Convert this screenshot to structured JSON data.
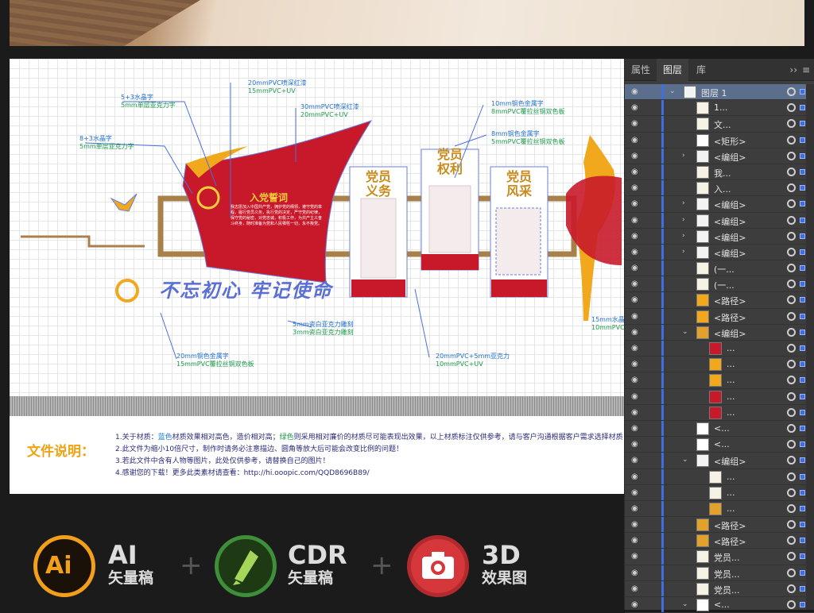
{
  "canvas": {
    "annotations": [
      {
        "a": "20mmPVC喷深红漆",
        "b": "15mmPVC+UV"
      },
      {
        "a": "5+3水晶字",
        "b": "5mm单层亚克力字"
      },
      {
        "a": "30mmPVC喷深红漆",
        "b": "20mmPVC+UV"
      },
      {
        "a": "8+3水晶字",
        "b": "5mm单层亚克力字"
      },
      {
        "a": "10mm铜色金属字",
        "b": "8mmPVC覆拉丝铜双色板"
      },
      {
        "a": "8mm铜色金属字",
        "b": "5mmPVC覆拉丝铜双色板"
      },
      {
        "a": "5mm瓷白亚克力雕刻",
        "b": "3mm瓷白亚克力雕刻"
      },
      {
        "a": "20mm铜色金属字",
        "b": "15mmPVC覆拉丝铜双色板"
      },
      {
        "a": "20mmPVC+5mm亚克力",
        "b": "10mmPVC+UV"
      },
      {
        "a": "15mm水晶",
        "b": "10mmPVC"
      }
    ],
    "slogan": "不忘初心 牢记使命",
    "oath_title": "入党誓词",
    "oath_body": "我志愿加入中国共产党，拥护党的纲领，遵守党的章程，履行党员义务，执行党的决定，严守党的纪律，保守党的秘密，对党忠诚，积极工作，为共产主义奋斗终身，随时准备为党和人民牺牲一切，永不叛党。",
    "panels": [
      {
        "line1": "党员",
        "line2": "义务"
      },
      {
        "line1": "党员",
        "line2": "权利"
      },
      {
        "line1": "党员",
        "line2": "风采"
      }
    ]
  },
  "notes": {
    "label": "文件说明：",
    "lines": [
      {
        "pre": "1.关于材质：",
        "hl1": "蓝色",
        "mid": "材质效果相对高色，造价相对高；",
        "hl2": "绿色",
        "post": "则采用相对廉价的材质尽可能表现出效果，以上材质标注仅供参考，请与客户沟通根据客户需求选择材质，或咨询"
      },
      {
        "pre": "2.此文件为缩小10倍尺寸，制作时请务必注意描边、圆角等放大后可能会改变比例的问题！"
      },
      {
        "pre": "3.若此文件中含有人物等图片，此处仅供参考，请替换自己的图片！"
      },
      {
        "pre": "4.感谢您的下载！更多此类素材请查看：http://hi.ooopic.com/QQD8696B89/"
      }
    ]
  },
  "footer": {
    "badges": [
      {
        "icon": "ai-icon",
        "glyph": "Ai",
        "big": "AI",
        "small": "矢量稿",
        "color": "#f29f1b"
      },
      {
        "icon": "coreldraw-icon",
        "glyph": "",
        "big": "CDR",
        "small": "矢量稿",
        "color": "#3e8e3a"
      },
      {
        "icon": "camera-icon",
        "glyph": "",
        "big": "3D",
        "small": "效果图",
        "color": "#d5373b"
      }
    ]
  },
  "layers_panel": {
    "tabs": [
      "属性",
      "图层",
      "库"
    ],
    "active_tab": "图层",
    "more_label": "››",
    "menu_label": "≡",
    "rows": [
      {
        "indent": 0,
        "twisty": "⌄",
        "name": "图层 1",
        "selected": true,
        "thumb": "layer"
      },
      {
        "indent": 1,
        "twisty": "",
        "name": "1...",
        "thumb": "text"
      },
      {
        "indent": 1,
        "twisty": "",
        "name": "文...",
        "thumb": "text"
      },
      {
        "indent": 1,
        "twisty": "",
        "name": "<矩形>",
        "thumb": "blank"
      },
      {
        "indent": 1,
        "twisty": "›",
        "name": "<编组>",
        "thumb": "group"
      },
      {
        "indent": 1,
        "twisty": "",
        "name": "我...",
        "thumb": "text"
      },
      {
        "indent": 1,
        "twisty": "",
        "name": "入...",
        "thumb": "text"
      },
      {
        "indent": 1,
        "twisty": "›",
        "name": "<编组>",
        "thumb": "group"
      },
      {
        "indent": 1,
        "twisty": "›",
        "name": "<编组>",
        "thumb": "group"
      },
      {
        "indent": 1,
        "twisty": "›",
        "name": "<编组>",
        "thumb": "group"
      },
      {
        "indent": 1,
        "twisty": "›",
        "name": "<编组>",
        "thumb": "group"
      },
      {
        "indent": 1,
        "twisty": "",
        "name": "(一...",
        "thumb": "text"
      },
      {
        "indent": 1,
        "twisty": "",
        "name": "(一...",
        "thumb": "text"
      },
      {
        "indent": 1,
        "twisty": "",
        "name": "<路径>",
        "thumb": "bird"
      },
      {
        "indent": 1,
        "twisty": "",
        "name": "<路径>",
        "thumb": "bird"
      },
      {
        "indent": 1,
        "twisty": "⌄",
        "name": "<编组>",
        "thumb": "emblem"
      },
      {
        "indent": 2,
        "twisty": "",
        "name": "...",
        "thumb": "red"
      },
      {
        "indent": 2,
        "twisty": "",
        "name": "...",
        "thumb": "orange"
      },
      {
        "indent": 2,
        "twisty": "",
        "name": "...",
        "thumb": "orange"
      },
      {
        "indent": 2,
        "twisty": "",
        "name": "...",
        "thumb": "red"
      },
      {
        "indent": 2,
        "twisty": "",
        "name": "...",
        "thumb": "red"
      },
      {
        "indent": 1,
        "twisty": "",
        "name": "<...",
        "thumb": "blank"
      },
      {
        "indent": 1,
        "twisty": "",
        "name": "<...",
        "thumb": "blank"
      },
      {
        "indent": 1,
        "twisty": "⌄",
        "name": "<编组>",
        "thumb": "group"
      },
      {
        "indent": 2,
        "twisty": "",
        "name": "...",
        "thumb": "text"
      },
      {
        "indent": 2,
        "twisty": "",
        "name": "...",
        "thumb": "text"
      },
      {
        "indent": 2,
        "twisty": "",
        "name": "...",
        "thumb": "emblem"
      },
      {
        "indent": 1,
        "twisty": "",
        "name": "<路径>",
        "thumb": "emblem"
      },
      {
        "indent": 1,
        "twisty": "",
        "name": "<路径>",
        "thumb": "emblem"
      },
      {
        "indent": 1,
        "twisty": "",
        "name": "党员...",
        "thumb": "text"
      },
      {
        "indent": 1,
        "twisty": "",
        "name": "党员...",
        "thumb": "text"
      },
      {
        "indent": 1,
        "twisty": "",
        "name": "党员...",
        "thumb": "text"
      },
      {
        "indent": 1,
        "twisty": "⌄",
        "name": "<...",
        "thumb": "blank"
      }
    ]
  }
}
